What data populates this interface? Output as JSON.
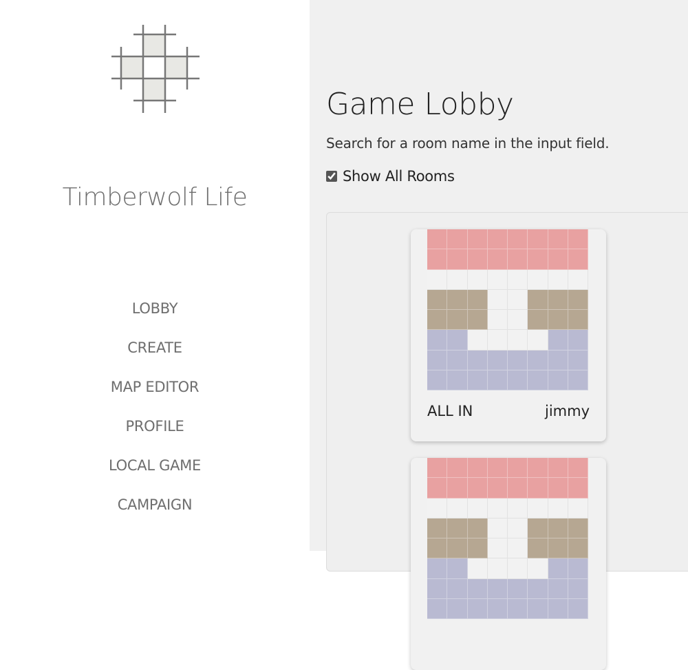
{
  "app": {
    "title": "Timberwolf Life"
  },
  "nav": {
    "items": [
      {
        "label": "LOBBY"
      },
      {
        "label": "CREATE"
      },
      {
        "label": "MAP EDITOR"
      },
      {
        "label": "PROFILE"
      },
      {
        "label": "LOCAL GAME"
      },
      {
        "label": "CAMPAIGN"
      }
    ]
  },
  "main": {
    "title": "Game Lobby",
    "subtitle": "Search for a room name in the input field.",
    "show_all": {
      "label": "Show All Rooms",
      "checked": true
    }
  },
  "colors": {
    "red": "#e8a1a1",
    "tan": "#b6a792",
    "blue": "#b9bad2",
    "white": "#f2f2f2",
    "logo_fill": "#e8e8e4",
    "logo_line": "#777777"
  },
  "rooms": [
    {
      "status": "ALL IN",
      "owner": "jimmy",
      "map": [
        "RRRRRRRR",
        "RRRRRRRR",
        "WWWWWWWW",
        "TTTWWTTT",
        "TTTWWTTT",
        "BBWWWWBB",
        "BBBBBBBB",
        "BBBBBBBB"
      ]
    },
    {
      "status": "",
      "owner": "",
      "map": [
        "RRRRRRRR",
        "RRRRRRRR",
        "WWWWWWWW",
        "TTTWWTTT",
        "TTTWWTTT",
        "BBWWWWBB",
        "BBBBBBBB",
        "BBBBBBBB"
      ]
    }
  ]
}
